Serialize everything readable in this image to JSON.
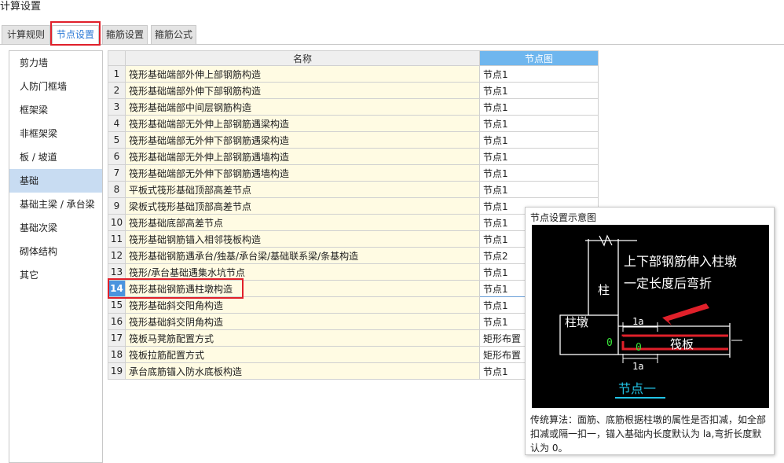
{
  "window": {
    "title": "计算设置"
  },
  "tabs": [
    {
      "label": "计算规则"
    },
    {
      "label": "节点设置"
    },
    {
      "label": "箍筋设置"
    },
    {
      "label": "箍筋公式"
    }
  ],
  "sidebar": {
    "items": [
      {
        "label": "剪力墙"
      },
      {
        "label": "人防门框墙"
      },
      {
        "label": "框架梁"
      },
      {
        "label": "非框架梁"
      },
      {
        "label": "板 / 坡道"
      },
      {
        "label": "基础"
      },
      {
        "label": "基础主梁 / 承台梁"
      },
      {
        "label": "基础次梁"
      },
      {
        "label": "砌体结构"
      },
      {
        "label": "其它"
      }
    ],
    "selected": "基础"
  },
  "table": {
    "headers": {
      "name": "名称",
      "node": "节点图"
    },
    "rows": [
      {
        "index": "1",
        "name": "筏形基础端部外伸上部钢筋构造",
        "node": "节点1"
      },
      {
        "index": "2",
        "name": "筏形基础端部外伸下部钢筋构造",
        "node": "节点1"
      },
      {
        "index": "3",
        "name": "筏形基础端部中间层钢筋构造",
        "node": "节点1"
      },
      {
        "index": "4",
        "name": "筏形基础端部无外伸上部钢筋遇梁构造",
        "node": "节点1"
      },
      {
        "index": "5",
        "name": "筏形基础端部无外伸下部钢筋遇梁构造",
        "node": "节点1"
      },
      {
        "index": "6",
        "name": "筏形基础端部无外伸上部钢筋遇墙构造",
        "node": "节点1"
      },
      {
        "index": "7",
        "name": "筏形基础端部无外伸下部钢筋遇墙构造",
        "node": "节点1"
      },
      {
        "index": "8",
        "name": "平板式筏形基础顶部高差节点",
        "node": "节点1"
      },
      {
        "index": "9",
        "name": "梁板式筏形基础顶部高差节点",
        "node": "节点1"
      },
      {
        "index": "10",
        "name": "筏形基础底部高差节点",
        "node": "节点1"
      },
      {
        "index": "11",
        "name": "筏形基础钢筋锚入相邻筏板构造",
        "node": "节点1"
      },
      {
        "index": "12",
        "name": "筏形基础钢筋遇承台/独基/承台梁/基础联系梁/条基构造",
        "node": "节点2"
      },
      {
        "index": "13",
        "name": "筏形/承台基础遇集水坑节点",
        "node": "节点1"
      },
      {
        "index": "14",
        "name": "筏形基础钢筋遇柱墩构造",
        "node": "节点1"
      },
      {
        "index": "15",
        "name": "筏形基础斜交阳角构造",
        "node": "节点1"
      },
      {
        "index": "16",
        "name": "筏形基础斜交阴角构造",
        "node": "节点1"
      },
      {
        "index": "17",
        "name": "筏板马凳筋配置方式",
        "node": "矩形布置"
      },
      {
        "index": "18",
        "name": "筏板拉筋配置方式",
        "node": "矩形布置"
      },
      {
        "index": "19",
        "name": "承台底筋锚入防水底板构造",
        "node": "节点1"
      }
    ],
    "selected_index": "14"
  },
  "popup": {
    "title": "节点设置示意图",
    "diagram": {
      "line1": "上下部钢筋伸入柱墩",
      "line2": "一定长度后弯折",
      "column_label": "柱",
      "pier_label": "柱墩",
      "raft_label": "筏板",
      "dim_top": "1a",
      "dim_bottom": "1a",
      "zero_left": "0",
      "zero_mid": "0",
      "caption": "节点一"
    },
    "description": "传统算法：面筋、底筋根据柱墩的属性是否扣减，如全部扣减或隔一扣一，锚入基础内长度默认为 la,弯折长度默认为 0。"
  },
  "colors": {
    "accent_blue": "#2a78d6",
    "highlight_red": "#e0202a",
    "header_selected": "#6fb6ee",
    "row_selected": "#4a94de",
    "name_cell_bg": "#fffbe3",
    "sidebar_selected": "#c8dcf2"
  }
}
